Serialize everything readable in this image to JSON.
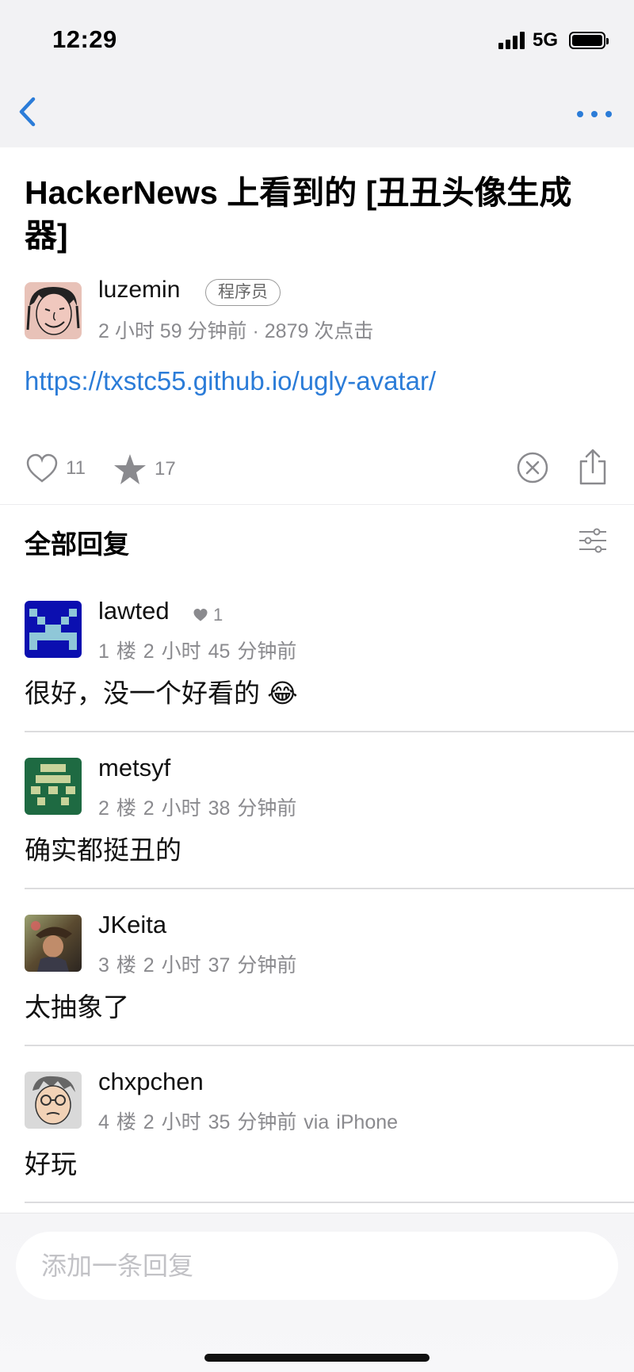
{
  "status_bar": {
    "time": "12:29",
    "network": "5G"
  },
  "post": {
    "title": "HackerNews 上看到的 [丑丑头像生成器]",
    "author": {
      "name": "luzemin",
      "tag": "程序员"
    },
    "meta": "2 小时 59 分钟前 · 2879 次点击",
    "link": "https://txstc55.github.io/ugly-avatar/",
    "likes": "11",
    "favorites": "17"
  },
  "replies_header": "全部回复",
  "replies": [
    {
      "name": "lawted",
      "likes": "1",
      "floor": "1 楼   2 小时 45 分钟前",
      "content": "很好，没一个好看的 😂"
    },
    {
      "name": "metsyf",
      "floor": "2 楼   2 小时 38 分钟前",
      "content": "确实都挺丑的"
    },
    {
      "name": "JKeita",
      "floor": "3 楼   2 小时 37 分钟前",
      "content": "太抽象了"
    },
    {
      "name": "chxpchen",
      "floor": "4 楼   2 小时 35 分钟前 via iPhone",
      "content": "好玩"
    }
  ],
  "compose": {
    "placeholder": "添加一条回复"
  },
  "colors": {
    "accent": "#2b7cd8",
    "muted": "#8a8a8e",
    "nav_bg": "#f2f2f4"
  }
}
